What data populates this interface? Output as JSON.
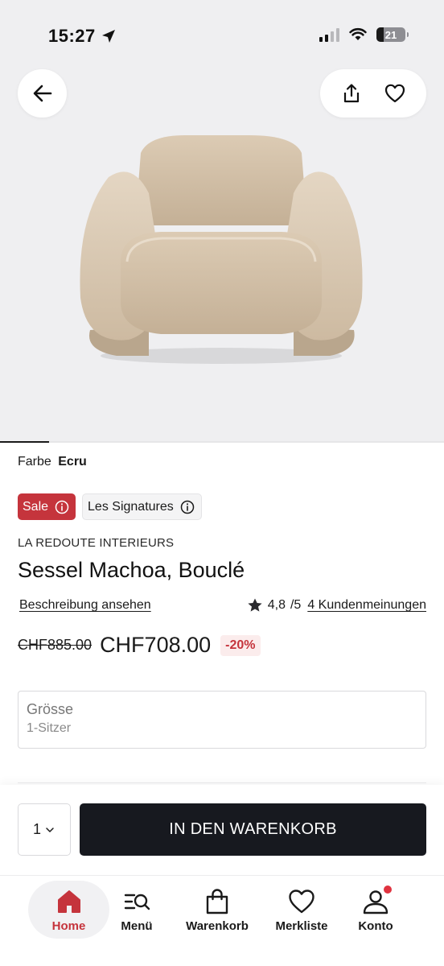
{
  "status_bar": {
    "time": "15:27",
    "battery": "21"
  },
  "header": {
    "back_icon": "arrow-left-icon",
    "share_icon": "share-icon",
    "wishlist_icon": "heart-icon"
  },
  "gallery": {
    "image_alt_icon": "armchair-image",
    "progress_fraction": 0.11
  },
  "product": {
    "color_label": "Farbe",
    "color_value": "Ecru",
    "badges": [
      {
        "label": "Sale",
        "color": "#c5343c"
      },
      {
        "label": "Les Signatures"
      }
    ],
    "brand": "LA REDOUTE INTERIEURS",
    "title": "Sessel Machoa, Bouclé",
    "description_link": "Beschreibung ansehen",
    "rating": "4,8",
    "rating_max": "/5",
    "reviews_link": "4 Kundenmeinungen",
    "old_price": "CHF885.00",
    "new_price": "CHF708.00",
    "discount": "-20%",
    "size_label": "Grösse",
    "size_value": "1-Sitzer"
  },
  "cart_bar": {
    "quantity": "1",
    "add_to_cart": "IN DEN WARENKORB",
    "button_color": "#17191f"
  },
  "bottom_nav": {
    "items": [
      {
        "label": "Home",
        "icon": "home-icon",
        "active": true
      },
      {
        "label": "Menü",
        "icon": "menu-search-icon"
      },
      {
        "label": "Warenkorb",
        "icon": "shopping-bag-icon"
      },
      {
        "label": "Merkliste",
        "icon": "heart-icon"
      },
      {
        "label": "Konto",
        "icon": "user-icon",
        "notification": true
      }
    ],
    "accent_color": "#c5343c"
  }
}
